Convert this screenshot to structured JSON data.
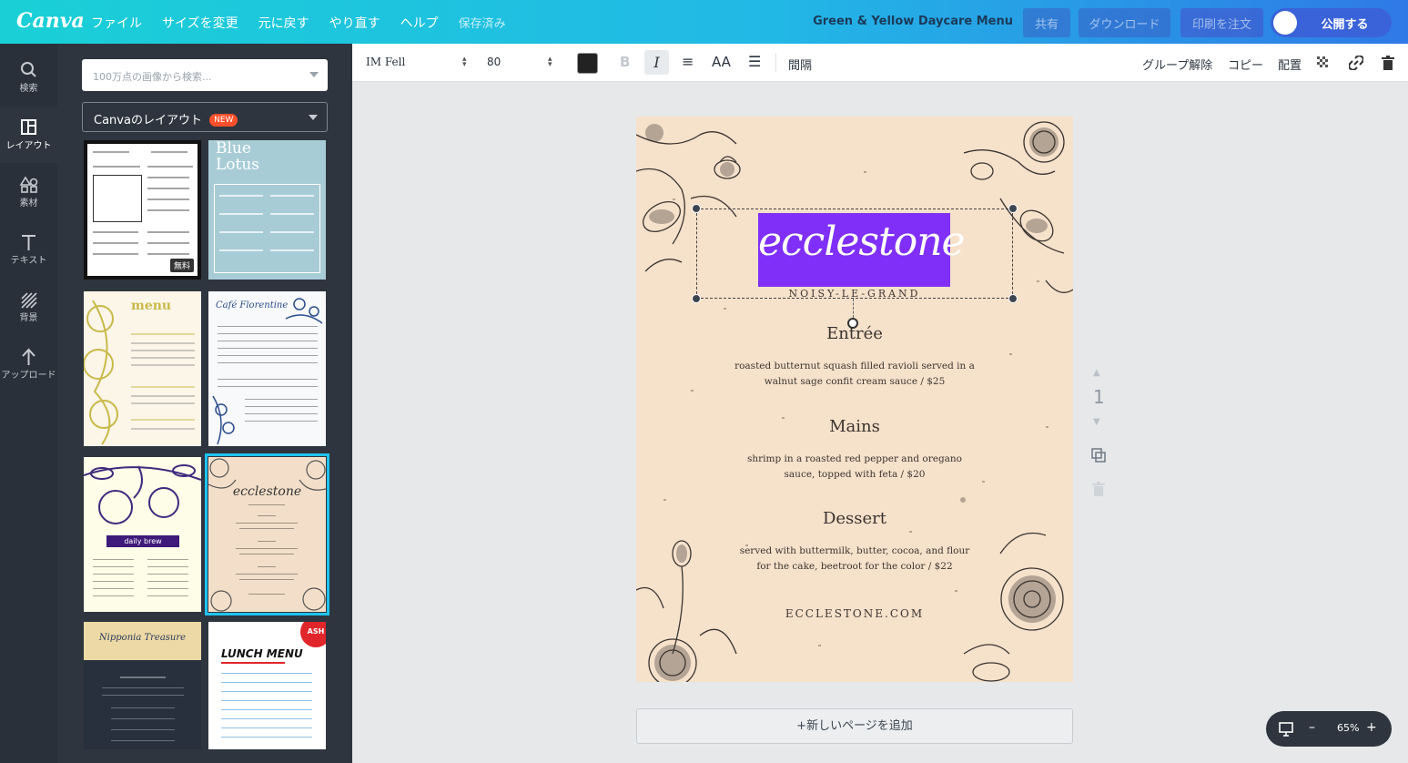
{
  "topbar": {
    "logo": "Canva",
    "menu": [
      "ファイル",
      "サイズを変更",
      "元に戻す",
      "やり直す",
      "ヘルプ"
    ],
    "status": "保存済み",
    "doc_name": "Green & Yellow Daycare Menu",
    "share": "共有",
    "download": "ダウンロード",
    "print": "印刷を注文",
    "publish": "公開する"
  },
  "rail": [
    {
      "label": "検索",
      "icon": "search-icon"
    },
    {
      "label": "レイアウト",
      "icon": "layout-icon"
    },
    {
      "label": "素材",
      "icon": "elements-icon"
    },
    {
      "label": "テキスト",
      "icon": "text-icon"
    },
    {
      "label": "背景",
      "icon": "background-icon"
    },
    {
      "label": "アップロード",
      "icon": "upload-icon"
    }
  ],
  "panel": {
    "search_placeholder": "100万点の画像から検索...",
    "layout_select": "Canvaのレイアウト",
    "new_badge": "NEW",
    "free_badge": "無料",
    "thumbs": {
      "t2_title": "Blue Lotus",
      "t3_title": "menu",
      "t4_title": "Café Florentine",
      "t5_bar": "daily brew",
      "t6_title": "ecclestone",
      "t7_title": "Nipponia Treasure",
      "t8_title": "LUNCH MENU",
      "t8_badge": "ASH"
    }
  },
  "toolbar": {
    "font": "IM Fell",
    "size": "80",
    "bold": "B",
    "italic": "I",
    "aa": "AA",
    "spacing": "間隔",
    "ungroup": "グループ解除",
    "copy": "コピー",
    "arrange": "配置"
  },
  "page": {
    "title": "ecclestone",
    "subtitle": "NOISY-LE-GRAND",
    "sections": [
      {
        "heading": "Entrée",
        "desc": "roasted butternut squash filled ravioli served in a walnut sage confit cream sauce / $25"
      },
      {
        "heading": "Mains",
        "desc": "shrimp in a roasted red pepper and oregano sauce, topped with feta / $20"
      },
      {
        "heading": "Dessert",
        "desc": "served with buttermilk, butter, cocoa, and flour for the cake, beetroot  for the color / $22"
      }
    ],
    "site": "ECCLESTONE.COM",
    "page_number": "1"
  },
  "add_page": "+新しいページを追加",
  "zoom": {
    "minus": "–",
    "value": "65%",
    "plus": "+"
  },
  "colors": {
    "accent": "#7f2ff7",
    "page_bg": "#f6e1cb",
    "panel": "#2e353e"
  }
}
